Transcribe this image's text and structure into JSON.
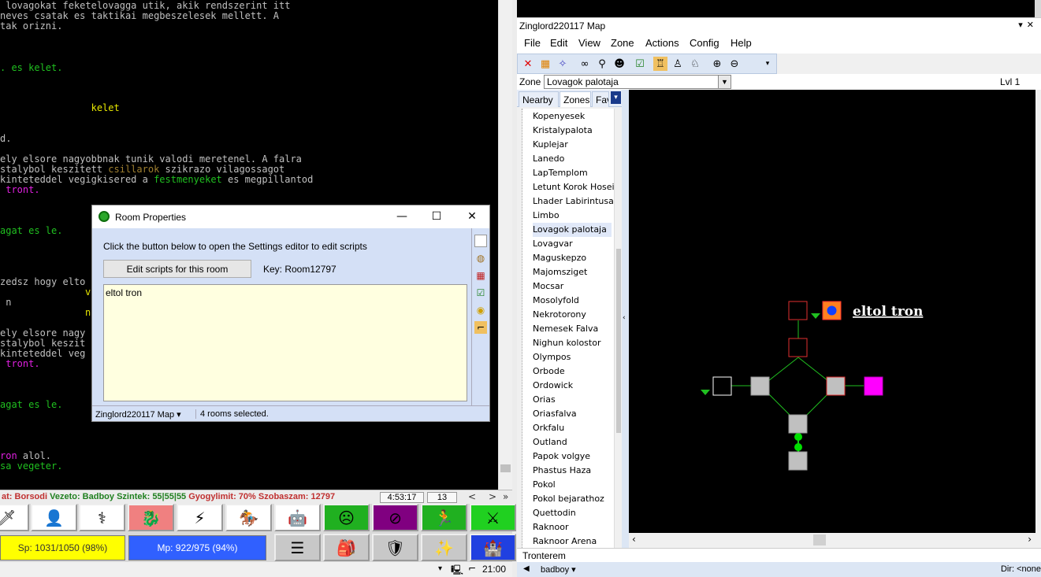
{
  "terminal": {
    "lines": [
      {
        "text": " lovagokat feketelovagga utik, akik rendszerint itt",
        "color": "#c0c0c0"
      },
      {
        "text": "neves csatak es taktikai megbeszelesek mellett. A",
        "color": "#c0c0c0"
      },
      {
        "text": "tak orizni.",
        "color": "#c0c0c0"
      },
      {
        "text": ". es kelet.",
        "color": "#20c020"
      },
      {
        "text": "                kelet",
        "color": "#e8e800"
      },
      {
        "text": "d.",
        "color": "#c0c0c0"
      },
      {
        "text": "ely elsore nagyobbnak tunik valodi meretenel. A falra",
        "color": "#c0c0c0"
      },
      {
        "text": "stalybol keszitett ",
        "color": "#c0c0c0"
      },
      {
        "text": "csillarok",
        "color": "#a08030"
      },
      {
        "text": " szikrazo vilagossagot",
        "color": "#c0c0c0"
      },
      {
        "text": "kinteteddel vegigkisered a ",
        "color": "#c0c0c0"
      },
      {
        "text": "festmenyeket",
        "color": "#20c020"
      },
      {
        "text": " es megpillantod",
        "color": "#c0c0c0"
      },
      {
        "text": " tront.",
        "color": "#e020e0"
      },
      {
        "text": "agat es le.",
        "color": "#20c020"
      },
      {
        "text": "zedsz hogy elto",
        "color": "#c0c0c0"
      },
      {
        "text": "v",
        "color": "#e8e800"
      },
      {
        "text": " n",
        "color": "#c0c0c0"
      },
      {
        "text": "n",
        "color": "#e8e800"
      },
      {
        "text": "ely elsore nagy",
        "color": "#c0c0c0"
      },
      {
        "text": "stalybol keszit",
        "color": "#c0c0c0"
      },
      {
        "text": "kinteteddel veg",
        "color": "#c0c0c0"
      },
      {
        "text": " tront.",
        "color": "#e020e0"
      },
      {
        "text": "agat es le.",
        "color": "#20c020"
      },
      {
        "text": "ron",
        "color": "#e020e0"
      },
      {
        "text": " alol.",
        "color": "#c0c0c0"
      },
      {
        "text": "sa vegeter.",
        "color": "#20c020"
      }
    ]
  },
  "status": {
    "prefix": "at: ",
    "name": "Borsodi",
    "leader_label": " Vezeto: Badboy",
    "levels_label": " Szintek: 55|55|55",
    "heal_label": " Gyogylimit: 70%",
    "room_label": " Szobaszam: 12797",
    "time": "4:53:17",
    "count": "13",
    "nav_left": "<",
    "nav_right": ">",
    "nav_end": "»"
  },
  "bars": {
    "sp": "Sp: 1031/1050 (98%)",
    "mp": "Mp: 922/975 (94%)"
  },
  "bottom": {
    "clock": "21:00"
  },
  "map": {
    "window_title": "Zinglord220117 Map",
    "menus": [
      "File",
      "Edit",
      "View",
      "Zone",
      "Actions",
      "Config",
      "Help"
    ],
    "zone_label": "Zone",
    "zone_value": "Lovagok palotaja",
    "level": "Lvl 1",
    "tabs": [
      "Nearby",
      "Zones",
      "Fav"
    ],
    "zones": [
      "Kopenyesek",
      "Kristalypalota",
      "Kuplejar",
      "Lanedo",
      "LapTemplom",
      "Letunt Korok Hosei",
      "Lhader Labirintusa",
      "Limbo",
      "Lovagok palotaja",
      "Lovagvar",
      "Maguskepzo",
      "Majomsziget",
      "Mocsar",
      "Mosolyfold",
      "Nekrotorony",
      "Nemesek Falva",
      "Nighun kolostor",
      "Olympos",
      "Orbode",
      "Ordowick",
      "Orias",
      "Oriasfalva",
      "Orkfalu",
      "Outland",
      "Papok volgye",
      "Phastus Haza",
      "Pokol",
      "Pokol bejarathoz",
      "Quettodin",
      "Raknoor",
      "Raknoor Arena"
    ],
    "selected_zone": "Lovagok palotaja",
    "map_label": "eltol tron",
    "room_name": "Tronterem",
    "user": "badboy",
    "dir": "Dir: <none"
  },
  "dialog": {
    "title": "Room Properties",
    "instruction": "Click the button below to open the Settings editor to edit scripts",
    "edit_button": "Edit scripts for this room",
    "key": "Key: Room12797",
    "notes": "eltol tron",
    "status_map": "Zinglord220117 Map",
    "status_rooms": "4 rooms selected."
  }
}
